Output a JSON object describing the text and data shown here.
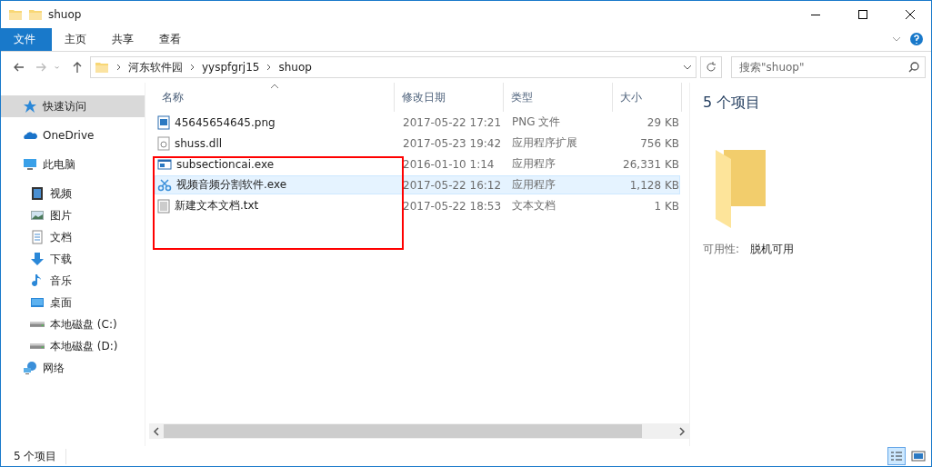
{
  "window": {
    "title": "shuop"
  },
  "ribbon": {
    "tabs": [
      {
        "label": "文件",
        "kind": "file"
      },
      {
        "label": "主页",
        "kind": "tab"
      },
      {
        "label": "共享",
        "kind": "tab"
      },
      {
        "label": "查看",
        "kind": "tab"
      }
    ]
  },
  "address": {
    "path": [
      "河东软件园",
      "yyspfgrj15",
      "shuop"
    ]
  },
  "search": {
    "placeholder": "搜索\"shuop\""
  },
  "sidebar": {
    "items": [
      {
        "label": "快速访问",
        "kind": "star",
        "selected": true
      },
      {
        "label": "OneDrive",
        "kind": "cloud",
        "selected": false
      },
      {
        "label": "此电脑",
        "kind": "pc",
        "selected": false,
        "children": [
          {
            "label": "视频",
            "kind": "video",
            "selected": false
          },
          {
            "label": "图片",
            "kind": "pictures",
            "selected": false
          },
          {
            "label": "文档",
            "kind": "docs",
            "selected": false
          },
          {
            "label": "下载",
            "kind": "download",
            "selected": false
          },
          {
            "label": "音乐",
            "kind": "music",
            "selected": false
          },
          {
            "label": "桌面",
            "kind": "desktop",
            "selected": false
          },
          {
            "label": "本地磁盘 (C:)",
            "kind": "drive",
            "selected": false
          },
          {
            "label": "本地磁盘 (D:)",
            "kind": "drive",
            "selected": false
          }
        ]
      },
      {
        "label": "网络",
        "kind": "network",
        "selected": false
      }
    ]
  },
  "table": {
    "columns": [
      {
        "label": "名称",
        "sorted": true
      },
      {
        "label": "修改日期",
        "sorted": false
      },
      {
        "label": "类型",
        "sorted": false
      },
      {
        "label": "大小",
        "sorted": false
      }
    ],
    "rows": [
      {
        "name": "45645654645.png",
        "date": "2017-05-22 17:21",
        "type": "PNG 文件",
        "size": "29 KB",
        "kind": "image",
        "hovered": false
      },
      {
        "name": "shuss.dll",
        "date": "2017-05-23 19:42",
        "type": "应用程序扩展",
        "size": "756 KB",
        "kind": "dll",
        "hovered": false
      },
      {
        "name": "subsectioncai.exe",
        "date": "2016-01-10 1:14",
        "type": "应用程序",
        "size": "26,331 KB",
        "kind": "exe",
        "hovered": false
      },
      {
        "name": "视频音频分割软件.exe",
        "date": "2017-05-22 16:12",
        "type": "应用程序",
        "size": "1,128 KB",
        "kind": "scissors",
        "hovered": true
      },
      {
        "name": "新建文本文档.txt",
        "date": "2017-05-22 18:53",
        "type": "文本文档",
        "size": "1 KB",
        "kind": "text",
        "hovered": false
      }
    ],
    "annotation": {
      "shown": true
    }
  },
  "details": {
    "title": "5 个项目",
    "fields": [
      {
        "label": "可用性:",
        "value": "脱机可用"
      }
    ]
  },
  "status_bar": {
    "text": "5 个项目",
    "views": [
      {
        "kind": "details",
        "selected": true
      },
      {
        "kind": "tiles",
        "selected": false
      }
    ]
  }
}
